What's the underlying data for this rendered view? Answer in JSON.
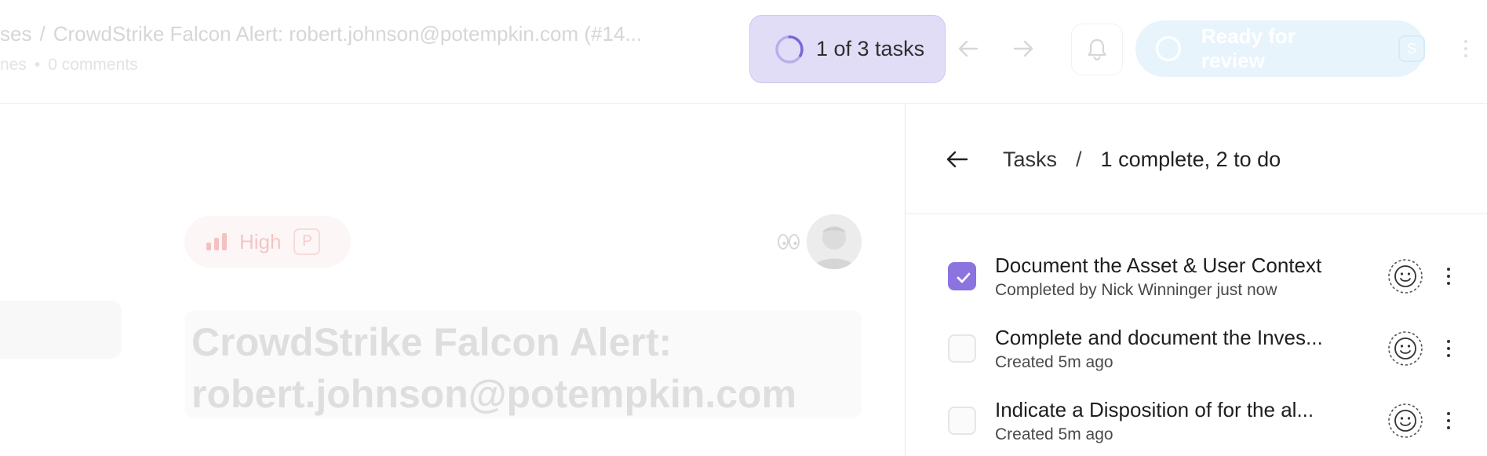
{
  "header": {
    "breadcrumb_prefix": "ses",
    "breadcrumb_sep": "/",
    "case_title": "CrowdStrike Falcon Alert: robert.johnson@potempkin.com (#14...",
    "sub_left": "nes",
    "sub_dot": "•",
    "comments": "0 comments",
    "task_progress": "1 of 3 tasks",
    "task_progress_fraction": 0.333,
    "review_label": "Ready for review",
    "review_key": "S"
  },
  "case": {
    "priority_label": "High",
    "priority_key": "P",
    "title": "CrowdStrike Falcon Alert: robert.johnson@potempkin.com"
  },
  "tasks_panel": {
    "heading": "Tasks",
    "sep": "/",
    "status": "1 complete, 2 to do",
    "tasks": [
      {
        "name": "Document the Asset & User Context",
        "meta": "Completed by Nick Winninger just now",
        "done": true
      },
      {
        "name": "Complete and document the Inves...",
        "meta": "Created 5m ago",
        "done": false
      },
      {
        "name": "Indicate a Disposition of for the al...",
        "meta": "Created 5m ago",
        "done": false
      }
    ]
  },
  "colors": {
    "accent": "#8b73e0",
    "pill_bg": "#e2ddf7",
    "review_bg": "#e8f4fc",
    "priority_faded": "#f3c6c6"
  }
}
